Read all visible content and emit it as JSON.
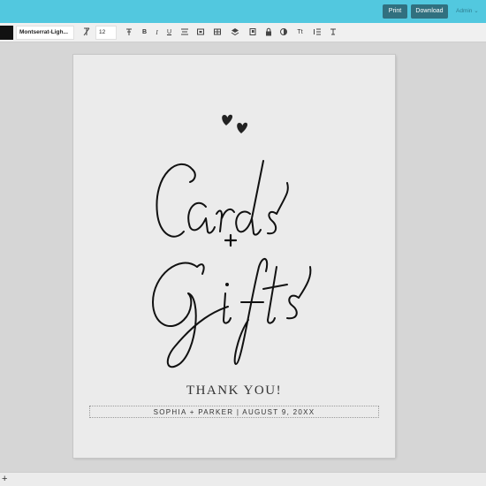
{
  "topbar": {
    "print_label": "Print",
    "download_label": "Download",
    "admin_label": "Admin ⌄"
  },
  "toolbar": {
    "font_value": "Montserrat-Ligh...",
    "font_size": "12",
    "text_color": "#111111",
    "tools": [
      "T",
      "T",
      "B",
      "I",
      "U",
      "≡",
      "▤",
      "▦",
      "▣",
      "■",
      "◐",
      "Tt",
      "☰",
      "⨁"
    ],
    "tool_icons": [
      "font-style-icon",
      "text-size-icon",
      "bold-icon",
      "italic-icon",
      "underline-icon",
      "align-icon",
      "layers-icon",
      "grid-icon",
      "frame-icon",
      "lock-icon",
      "opacity-icon",
      "case-icon",
      "line-spacing-icon",
      "clear-format-icon"
    ]
  },
  "page": {
    "script_line1": "Cards",
    "plus_sign": "+",
    "script_line2": "Gifts",
    "thank_you": "THANK YOU!",
    "names_line": "SOPHIA + PARKER | AUGUST 9, 20XX"
  },
  "bottombar": {
    "add_label": "+"
  },
  "colors": {
    "topbar": "#52c8df",
    "button": "#31707f",
    "canvas": "#d6d6d6",
    "page": "#ebebeb"
  }
}
